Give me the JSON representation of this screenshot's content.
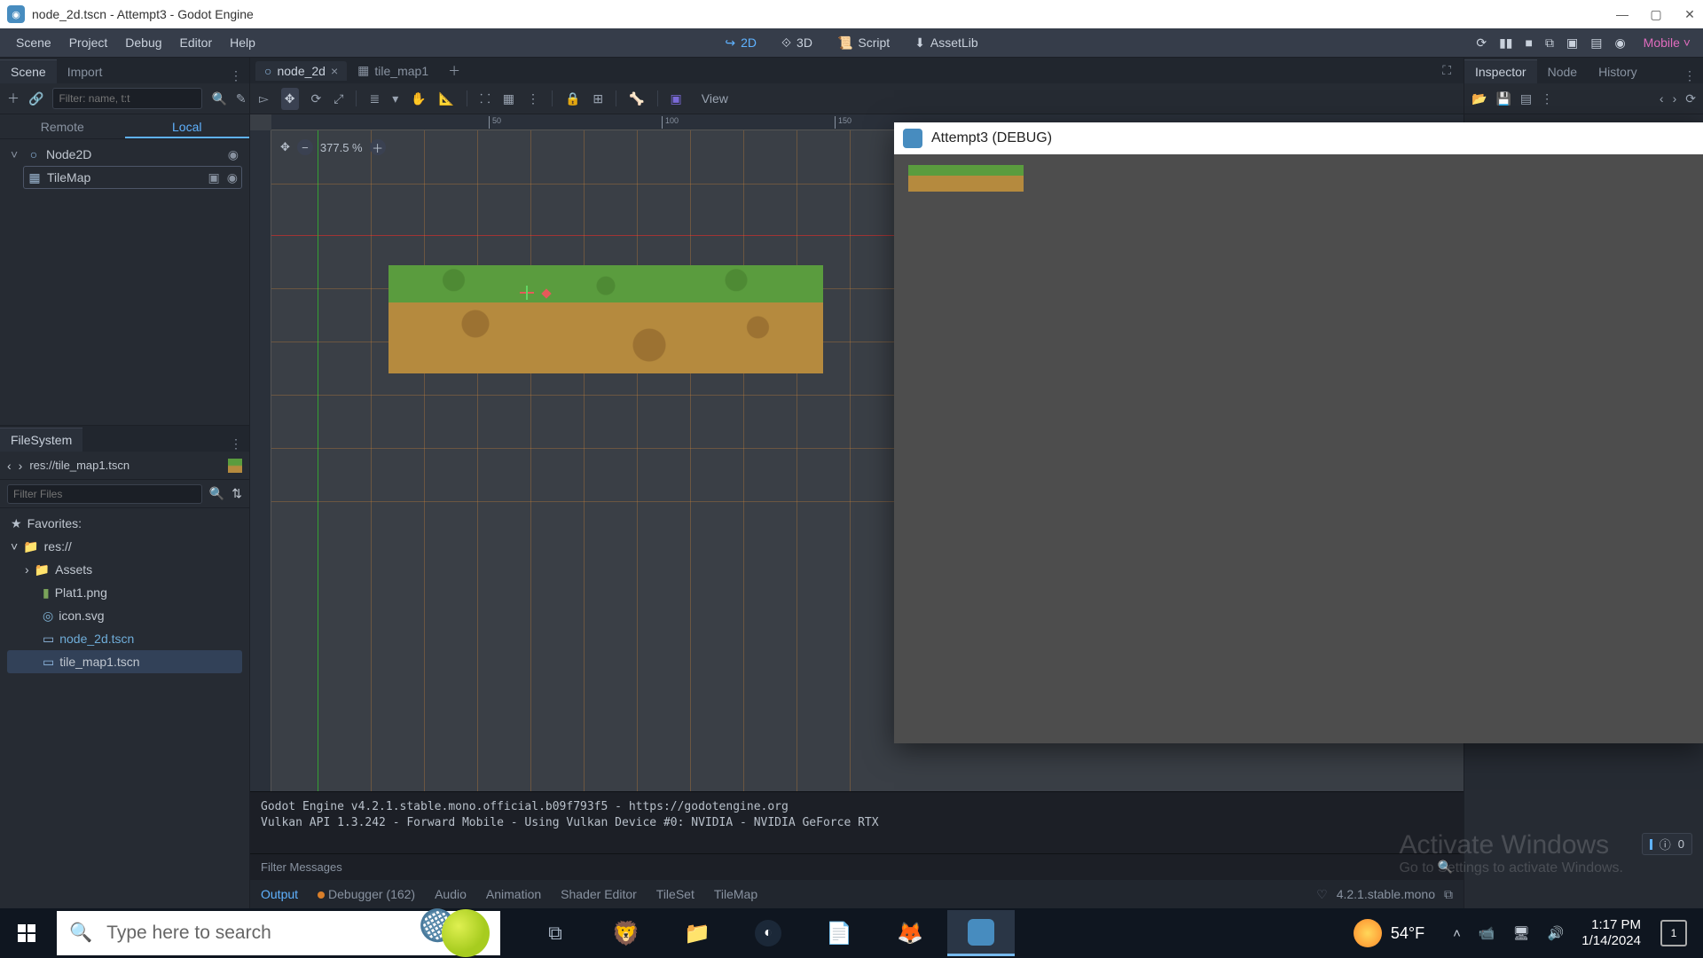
{
  "window_title": "node_2d.tscn - Attempt3 - Godot Engine",
  "menus": [
    "Scene",
    "Project",
    "Debug",
    "Editor",
    "Help"
  ],
  "workspaces": {
    "d2": "2D",
    "d3": "3D",
    "script": "Script",
    "asset": "AssetLib"
  },
  "renderer": "Mobile",
  "left": {
    "tabs": {
      "scene": "Scene",
      "import": "Import"
    },
    "add_filter_placeholder": "Filter: name, t:t",
    "remote": "Remote",
    "local": "Local",
    "tree": {
      "root": "Node2D",
      "child": "TileMap"
    },
    "fs_tab": "FileSystem",
    "fs_path": "res://tile_map1.tscn",
    "filter_files_placeholder": "Filter Files",
    "favorites": "Favorites:",
    "root_folder": "res://",
    "assets_folder": "Assets",
    "files": [
      "Plat1.png",
      "icon.svg",
      "node_2d.tscn",
      "tile_map1.tscn"
    ]
  },
  "center": {
    "tabs": [
      {
        "label": "node_2d",
        "circle": true,
        "active": true
      },
      {
        "label": "tile_map1",
        "circle": false,
        "active": false
      }
    ],
    "zoom": "377.5 %",
    "view_label": "View",
    "ruler_h": [
      "50",
      "100",
      "150"
    ],
    "output_lines": "Godot Engine v4.2.1.stable.mono.official.b09f793f5 - https://godotengine.org\nVulkan API 1.3.242 - Forward Mobile - Using Vulkan Device #0: NVIDIA - NVIDIA GeForce RTX",
    "filter_messages": "Filter Messages",
    "bottom_tabs": {
      "output": "Output",
      "debugger": "Debugger (162)",
      "audio": "Audio",
      "anim": "Animation",
      "shader": "Shader Editor",
      "tileset": "TileSet",
      "tilemap": "TileMap"
    },
    "version": "4.2.1.stable.mono"
  },
  "right": {
    "tabs": {
      "inspector": "Inspector",
      "node": "Node",
      "history": "History"
    },
    "info_count": "0"
  },
  "game_window": {
    "title": "Attempt3 (DEBUG)"
  },
  "watermark": {
    "title": "Activate Windows",
    "sub": "Go to Settings to activate Windows."
  },
  "taskbar": {
    "search_placeholder": "Type here to search",
    "weather": "54°F",
    "time": "1:17 PM",
    "date": "1/14/2024",
    "notif": "1"
  }
}
